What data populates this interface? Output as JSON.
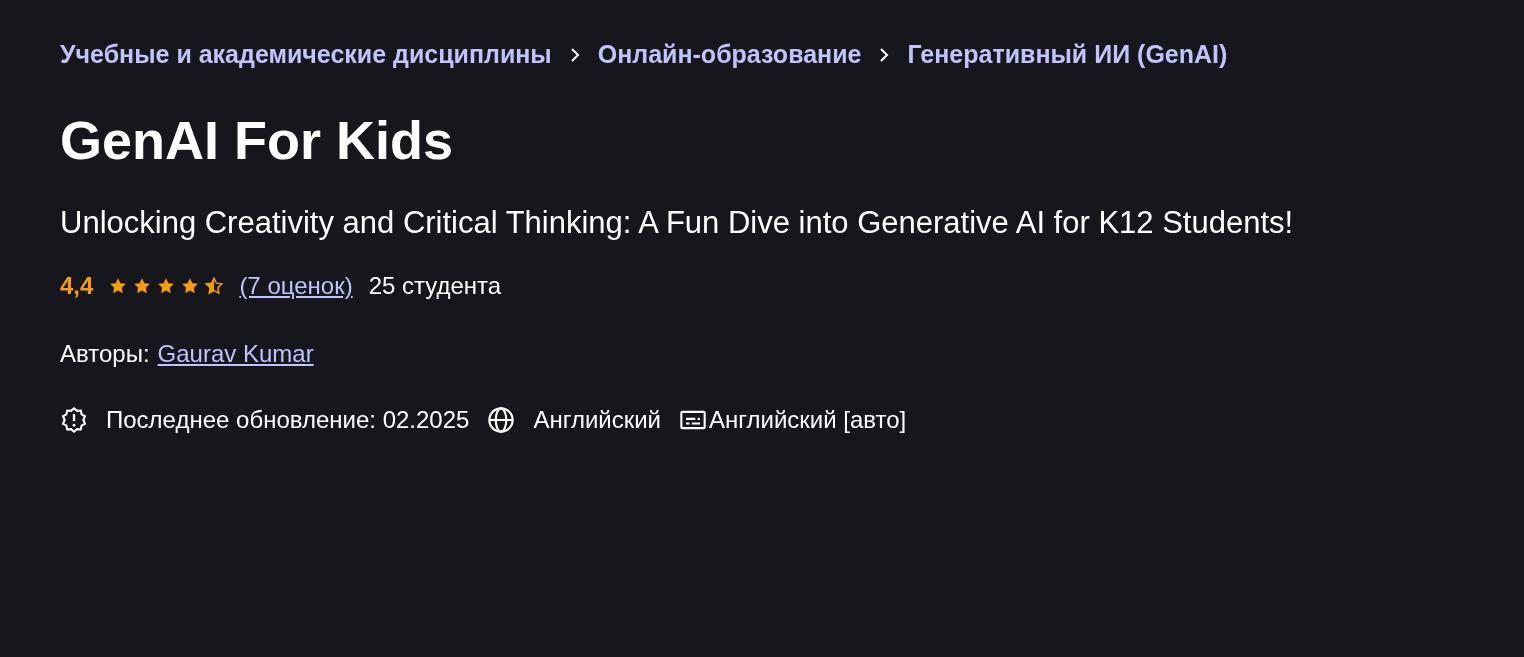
{
  "breadcrumbs": [
    {
      "label": "Учебные и академические дисциплины"
    },
    {
      "label": "Онлайн-образование"
    },
    {
      "label": "Генеративный ИИ (GenAI)"
    }
  ],
  "title": "GenAI For Kids",
  "subtitle": "Unlocking Creativity and Critical Thinking: A Fun Dive into Generative AI for K12 Students!",
  "rating": {
    "score": "4,4",
    "stars": 4.5,
    "reviews": "(7 оценок)",
    "students": "25 студента"
  },
  "authors": {
    "label": "Авторы:",
    "name": "Gaurav Kumar"
  },
  "meta": [
    {
      "kind": "updated",
      "text": "Последнее обновление: 02.2025"
    },
    {
      "kind": "language",
      "text": "Английский"
    },
    {
      "kind": "captions",
      "text": "Английский [авто]"
    }
  ]
}
